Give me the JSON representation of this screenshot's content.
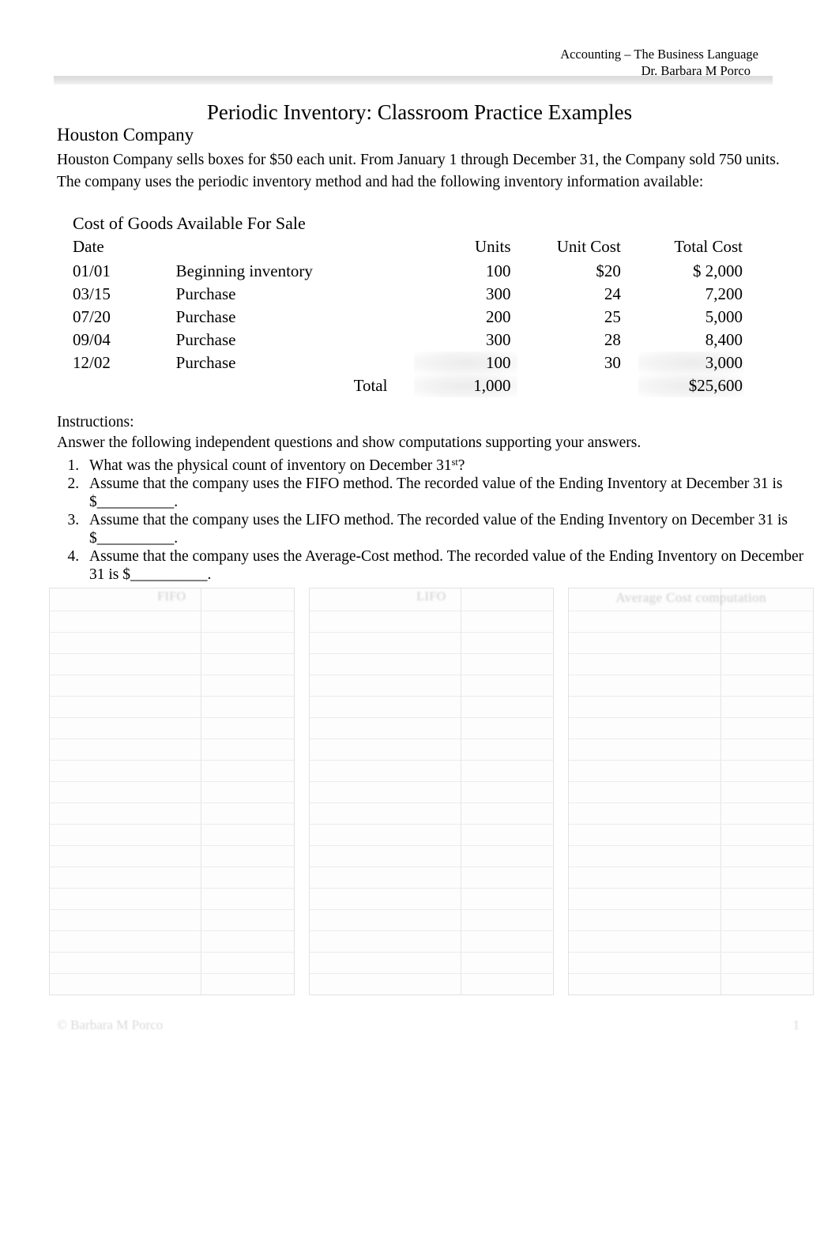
{
  "header": {
    "course": "Accounting – The Business Language",
    "instructor": "Dr. Barbara M Porco"
  },
  "title": "Periodic Inventory: Classroom Practice Examples",
  "company": {
    "name": "Houston Company",
    "description": "Houston Company sells boxes for $50 each unit. From January 1 through December 31, the Company sold 750 units. The company uses the periodic inventory method and had the following inventory information available:"
  },
  "cogs": {
    "caption": "Cost of Goods Available For Sale",
    "columns": [
      "Date",
      "",
      "Units",
      "Unit Cost",
      "Total Cost"
    ],
    "rows": [
      {
        "date": "01/01",
        "desc": "Beginning inventory",
        "units": "100",
        "unit_cost": "$20",
        "total_cost": "$  2,000"
      },
      {
        "date": "03/15",
        "desc": "Purchase",
        "units": "300",
        "unit_cost": "24",
        "total_cost": "7,200"
      },
      {
        "date": "07/20",
        "desc": "Purchase",
        "units": "200",
        "unit_cost": "25",
        "total_cost": "5,000"
      },
      {
        "date": "09/04",
        "desc": "Purchase",
        "units": "300",
        "unit_cost": "28",
        "total_cost": "8,400"
      },
      {
        "date": "12/02",
        "desc": "Purchase",
        "units": "100",
        "unit_cost": "30",
        "total_cost": "3,000"
      }
    ],
    "total": {
      "label": "Total",
      "units": "1,000",
      "unit_cost": "",
      "total_cost": "$25,600"
    }
  },
  "instructions": {
    "label": "Instructions:",
    "lead": "Answer the following independent questions and show computations supporting your answers.",
    "questions": [
      {
        "pre": "What was the physical count of inventory on December 31",
        "sup": "st",
        "post": "?"
      },
      {
        "pre": "Assume that the company uses the FIFO method. The recorded value of the  Ending Inventory    at December 31 is $",
        "sup": "",
        "post": "__________."
      },
      {
        "pre": "Assume that the company uses the LIFO method. The recorded value of the  Ending Inventory    on December 31 is $",
        "sup": "",
        "post": "__________."
      },
      {
        "pre": "Assume that the company uses the Average-Cost method. The recorded value of the  Ending Inventory    on December 31 is $",
        "sup": "",
        "post": "__________."
      }
    ]
  },
  "work_tables": [
    {
      "header": "FIFO",
      "rows": 18
    },
    {
      "header": "LIFO",
      "rows": 18
    },
    {
      "header": "Average Cost computation",
      "rows": 18
    }
  ],
  "footer": {
    "copyright": "© Barbara M Porco",
    "page_number": "1"
  }
}
